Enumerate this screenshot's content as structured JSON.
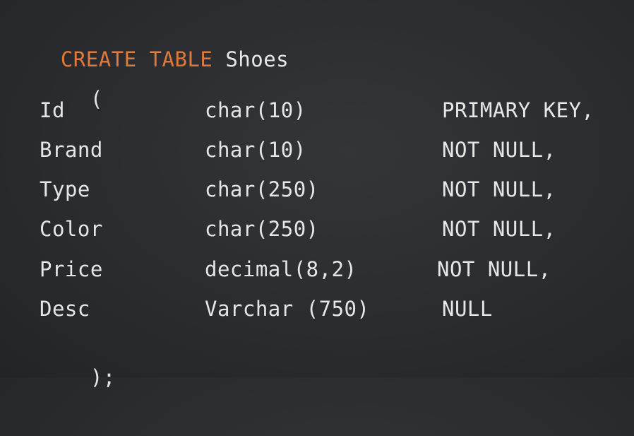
{
  "statement": {
    "keyword": "CREATE TABLE",
    "table_name": "Shoes",
    "open_paren": "(",
    "close": ");"
  },
  "columns": [
    {
      "name": "Id",
      "type": "char(10)",
      "constraint": "PRIMARY KEY,"
    },
    {
      "name": "Brand",
      "type": "char(10)",
      "constraint": "NOT NULL,"
    },
    {
      "name": "Type",
      "type": "char(250)",
      "constraint": "NOT NULL,"
    },
    {
      "name": "Color",
      "type": "char(250)",
      "constraint": "NOT NULL,"
    },
    {
      "name": "Price",
      "type": "decimal(8,2)",
      "constraint": "NOT NULL,"
    },
    {
      "name": "Desc",
      "type": "Varchar (750)",
      "constraint": "NULL"
    }
  ],
  "colors": {
    "keyword": "#e07a3b",
    "text": "#e8e8e8",
    "background": "#2a2c2f"
  }
}
